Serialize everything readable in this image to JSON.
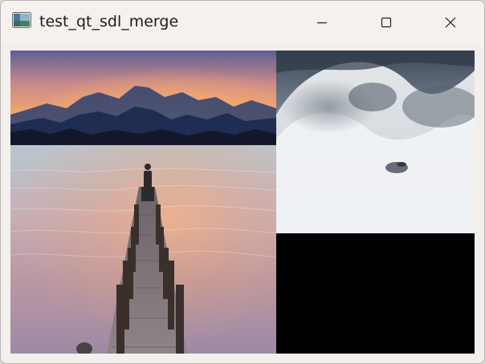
{
  "window": {
    "title": "test_qt_sdl_merge",
    "icon": "app-window-icon",
    "controls": [
      "minimize-icon",
      "maximize-icon",
      "close-icon"
    ]
  },
  "views": [
    {
      "name": "lake-pier-sunset-view",
      "content": "lake pier at sunset image"
    },
    {
      "name": "snow-dunes-view",
      "content": "snow dunes image with black lower area"
    }
  ],
  "colors": {
    "title_bar": "#f7f1ee",
    "window_border": "#b7b3b1",
    "client_background": "#fbfbfb",
    "empty_area": "#000000"
  }
}
